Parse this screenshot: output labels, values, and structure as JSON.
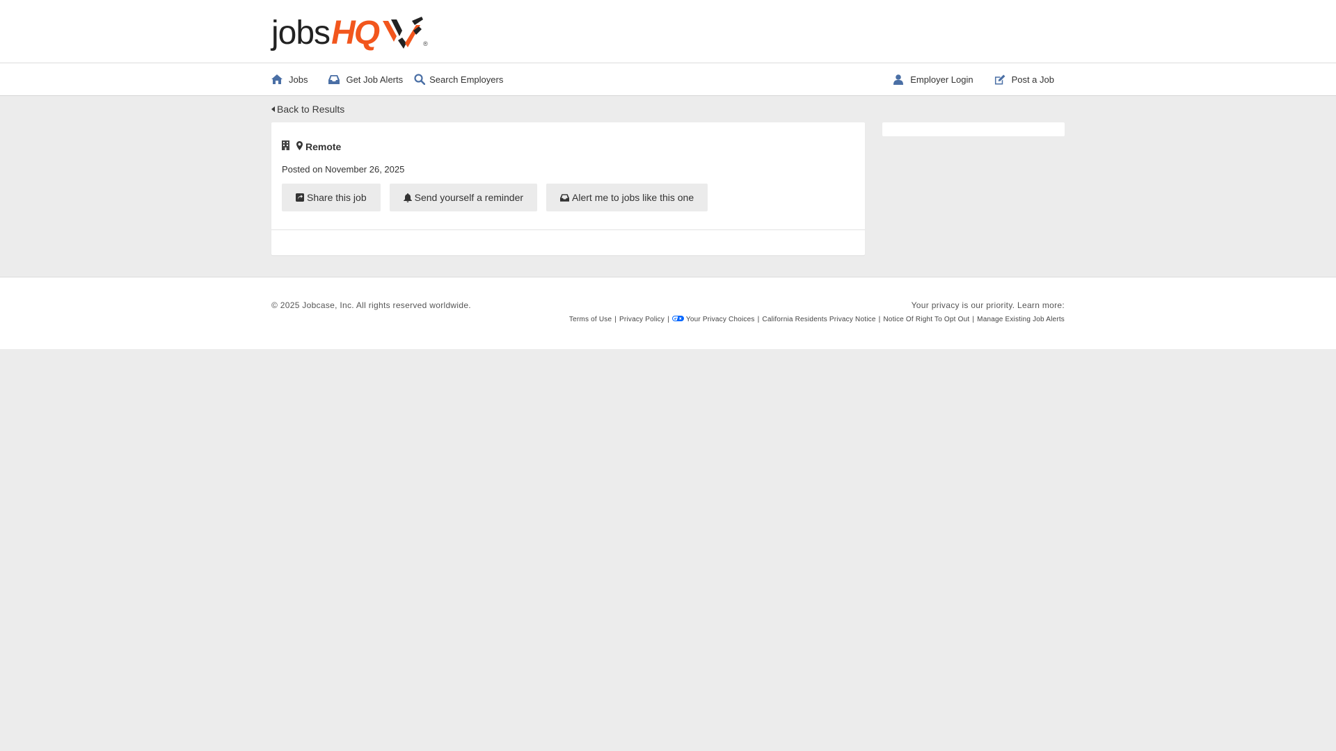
{
  "header": {
    "logo_jobs": "jobs",
    "logo_hq": "HQ",
    "logo_reg": "®",
    "brand_color": "#f2561d"
  },
  "nav": {
    "left": [
      {
        "label": "Jobs",
        "icon": "home-icon"
      },
      {
        "label": "Get Job Alerts",
        "icon": "inbox-icon"
      },
      {
        "label": "Search Employers",
        "icon": "search-icon"
      }
    ],
    "right": [
      {
        "label": "Employer Login",
        "icon": "user-icon"
      },
      {
        "label": "Post a Job",
        "icon": "edit-icon"
      }
    ],
    "icon_color": "#4a6fa5"
  },
  "main": {
    "back_label": "Back to Results",
    "job": {
      "location": "Remote",
      "posted": "Posted on November 26, 2025"
    },
    "actions": {
      "share": "Share this job",
      "reminder": "Send yourself a reminder",
      "alert": "Alert me to jobs like this one"
    }
  },
  "footer": {
    "copyright": "© 2025 Jobcase, Inc. All rights reserved worldwide.",
    "privacy_heading": "Your privacy is our priority. Learn more:",
    "links": {
      "terms": "Terms of Use",
      "privacy_policy": "Privacy Policy",
      "privacy_choices": "Your Privacy Choices",
      "california": "California Residents Privacy Notice",
      "opt_out": "Notice Of Right To Opt Out",
      "manage_alerts": "Manage Existing Job Alerts"
    },
    "separator": "|"
  }
}
